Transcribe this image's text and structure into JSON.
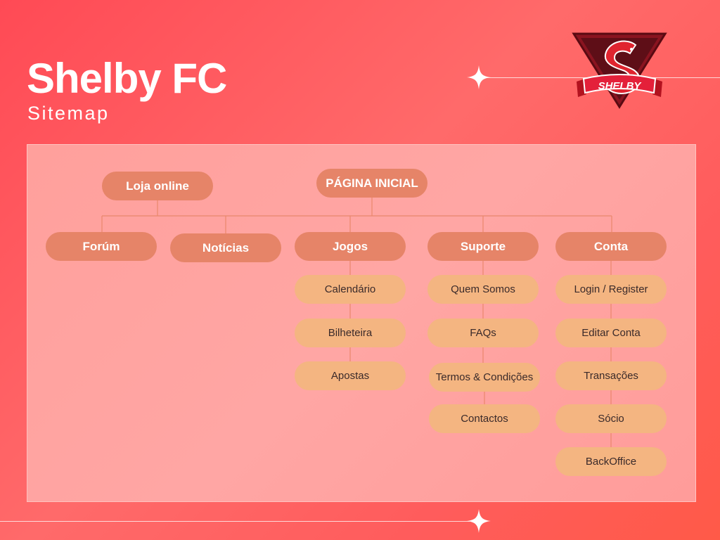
{
  "header": {
    "title": "Shelby FC",
    "subtitle": "Sitemap"
  },
  "logo": {
    "text": "SHELBY",
    "icon": "snake-shield-icon"
  },
  "colors": {
    "background": "#ff5a5a",
    "panel": "#ffa3a0",
    "primary_node": "#e68468",
    "secondary_node": "#f4b581",
    "connector": "#e8876c"
  },
  "sitemap": {
    "root": "PÁGINA INICIAL",
    "side": "Loja online",
    "sections": [
      {
        "label": "Forúm",
        "children": []
      },
      {
        "label": "Notícias",
        "children": []
      },
      {
        "label": "Jogos",
        "children": [
          "Calendário",
          "Bilheteira",
          "Apostas"
        ]
      },
      {
        "label": "Suporte",
        "children": [
          "Quem Somos",
          "FAQs",
          "Termos & Condições",
          "Contactos"
        ]
      },
      {
        "label": "Conta",
        "children": [
          "Login / Register",
          "Editar Conta",
          "Transações",
          "Sócio",
          "BackOffice"
        ]
      }
    ]
  }
}
